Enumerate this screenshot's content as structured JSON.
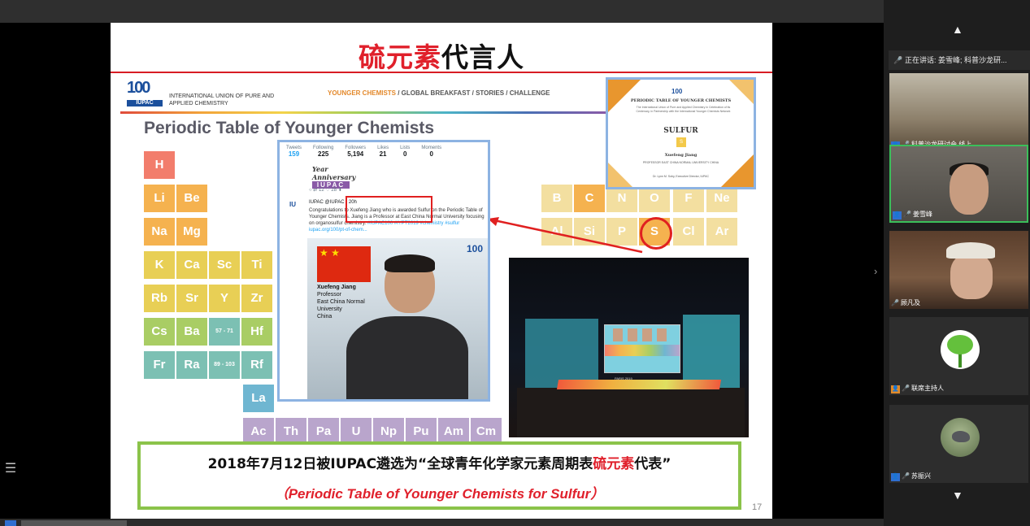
{
  "slide": {
    "title_red": "硫元素",
    "title_black": "代言人",
    "iupac": {
      "logo": "100",
      "badge": "IUPAC",
      "name": "INTERNATIONAL UNION OF PURE AND APPLIED CHEMISTRY"
    },
    "tagline_highlight": "YOUNGER CHEMISTS",
    "tagline_rest": " / GLOBAL BREAKFAST / STORIES / CHALLENGE",
    "pt_title": "Periodic Table of Younger Chemists",
    "elements": [
      {
        "symbol": "H",
        "color": "red"
      },
      {
        "symbol": "Li",
        "color": "orange"
      },
      {
        "symbol": "Be",
        "color": "orange"
      },
      {
        "symbol": "Na",
        "color": "orange"
      },
      {
        "symbol": "Mg",
        "color": "orange"
      },
      {
        "symbol": "K",
        "color": "yellow"
      },
      {
        "symbol": "Ca",
        "color": "yellow"
      },
      {
        "symbol": "Sc",
        "color": "yellow"
      },
      {
        "symbol": "Ti",
        "color": "yellow"
      },
      {
        "symbol": "Rb",
        "color": "yellow"
      },
      {
        "symbol": "Sr",
        "color": "yellow"
      },
      {
        "symbol": "Y",
        "color": "yellow"
      },
      {
        "symbol": "Zr",
        "color": "yellow"
      },
      {
        "symbol": "Cs",
        "color": "green"
      },
      {
        "symbol": "Ba",
        "color": "green"
      },
      {
        "symbol": "57 - 71",
        "color": "teal"
      },
      {
        "symbol": "Hf",
        "color": "green"
      },
      {
        "symbol": "Fr",
        "color": "teal"
      },
      {
        "symbol": "Ra",
        "color": "teal"
      },
      {
        "symbol": "89 - 103",
        "color": "teal"
      },
      {
        "symbol": "Rf",
        "color": "teal"
      },
      {
        "symbol": "B",
        "color": "faded"
      },
      {
        "symbol": "C",
        "color": "orange"
      },
      {
        "symbol": "N",
        "color": "faded"
      },
      {
        "symbol": "O",
        "color": "faded"
      },
      {
        "symbol": "F",
        "color": "faded"
      },
      {
        "symbol": "Ne",
        "color": "faded"
      },
      {
        "symbol": "Al",
        "color": "faded"
      },
      {
        "symbol": "Si",
        "color": "faded"
      },
      {
        "symbol": "P",
        "color": "faded"
      },
      {
        "symbol": "S",
        "color": "orange"
      },
      {
        "symbol": "Cl",
        "color": "faded"
      },
      {
        "symbol": "Ar",
        "color": "faded"
      },
      {
        "symbol": "La",
        "color": "blue"
      },
      {
        "symbol": "Ac",
        "color": "lav"
      },
      {
        "symbol": "Th",
        "color": "lav"
      },
      {
        "symbol": "Pa",
        "color": "lav"
      },
      {
        "symbol": "U",
        "color": "lav"
      },
      {
        "symbol": "Np",
        "color": "lav"
      },
      {
        "symbol": "Pu",
        "color": "lav"
      },
      {
        "symbol": "Am",
        "color": "lav"
      },
      {
        "symbol": "Cm",
        "color": "lav"
      }
    ],
    "tweet": {
      "stats": [
        {
          "label": "Tweets",
          "value": "159"
        },
        {
          "label": "Following",
          "value": "225"
        },
        {
          "label": "Followers",
          "value": "5,194"
        },
        {
          "label": "Likes",
          "value": "21"
        },
        {
          "label": "Lists",
          "value": "0"
        },
        {
          "label": "Moments",
          "value": "0"
        }
      ],
      "banner_script": "Year Anniversary",
      "banner_iupac": "IUPAC",
      "actions": "○   ⇄ 12   ♡ 28   ⬇",
      "header": "IUPAC @IUPAC · 20h",
      "body": "Congratulations to Xuefeng Jiang who is awarded Sulfur on the Periodic Table of Younger Chemists. Jiang is a Professor at East China Normal University focusing on organosulfur chemistry.",
      "hashtags": "#IUPAC100 #IYPT2019 #chemistry #sulfur",
      "link": "iupac.org/100/pt-of-chem...",
      "caption_name": "Xuefeng Jiang",
      "caption_title": "Professor",
      "caption_univ": "East China Normal University",
      "caption_country": "China",
      "flag_stars": "★ ★"
    },
    "certificate": {
      "heading": "PERIODIC TABLE OF YOUNGER CHEMISTS",
      "sub": "The International Union of Pure and Applied Chemistry in Celebration of its Centenary, in Partnership with the International Younger Chemists Network",
      "element": "SULFUR",
      "symbol": "S",
      "name": "Xuefeng Jiang",
      "institution": "PROFESSOR  EAST CHINA NORMAL UNIVERSITY  CHINA",
      "signature": "Dr. Lynn M. Soby, Executive Director, IUPAC"
    },
    "stage_text": "PARIS 2019",
    "banner_cn_prefix": "2018年7月12日被IUPAC遴选为“全球青年化学家元素周期表",
    "banner_cn_red": "硫元素",
    "banner_cn_suffix": "代表”",
    "banner_en": "（Periodic Table of Younger Chemists for Sulfur）",
    "page_number": "17"
  },
  "panel": {
    "speaking": "正在讲话: 姜雪峰; 科普沙龙研...",
    "participants": [
      {
        "name": "科普沙龙研讨会 线上",
        "icon": "user-icon"
      },
      {
        "name": "姜雪峰",
        "icon": "user-icon"
      },
      {
        "name": "顾凡及",
        "icon": "user-icon"
      },
      {
        "name": "联席主持人",
        "icon": "user-icon"
      },
      {
        "name": "苏振兴",
        "icon": "user-icon"
      }
    ]
  }
}
